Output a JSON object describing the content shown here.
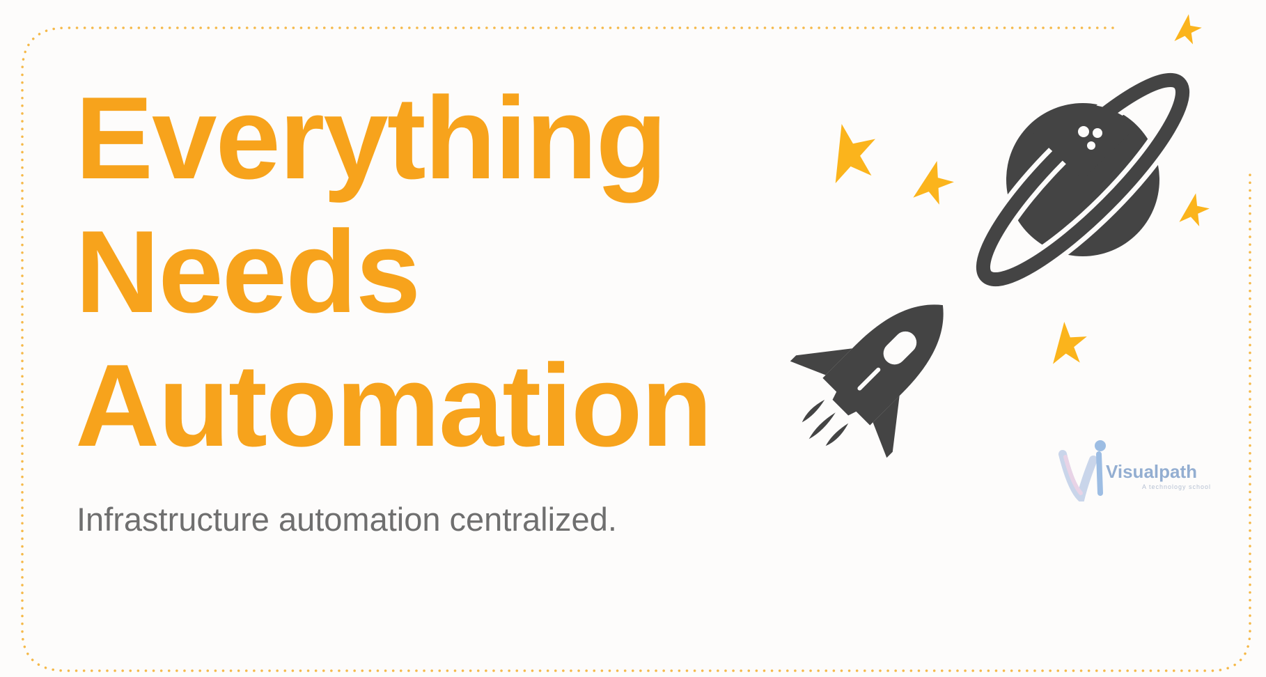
{
  "slide": {
    "title_lines": [
      "Everything",
      "Needs",
      "Automation"
    ],
    "subtitle": "Infrastructure automation centralized."
  },
  "logo": {
    "name": "Visualpath",
    "tagline": "A technology school"
  },
  "illustration": {
    "icons": [
      "planet-icon",
      "rocket-icon",
      "star-icon"
    ]
  },
  "colors": {
    "accent": "#f7a31c",
    "star": "#fbb41c",
    "icon_dark": "#444444",
    "subtitle": "#6f6f6f",
    "background": "#fdfcfb"
  }
}
